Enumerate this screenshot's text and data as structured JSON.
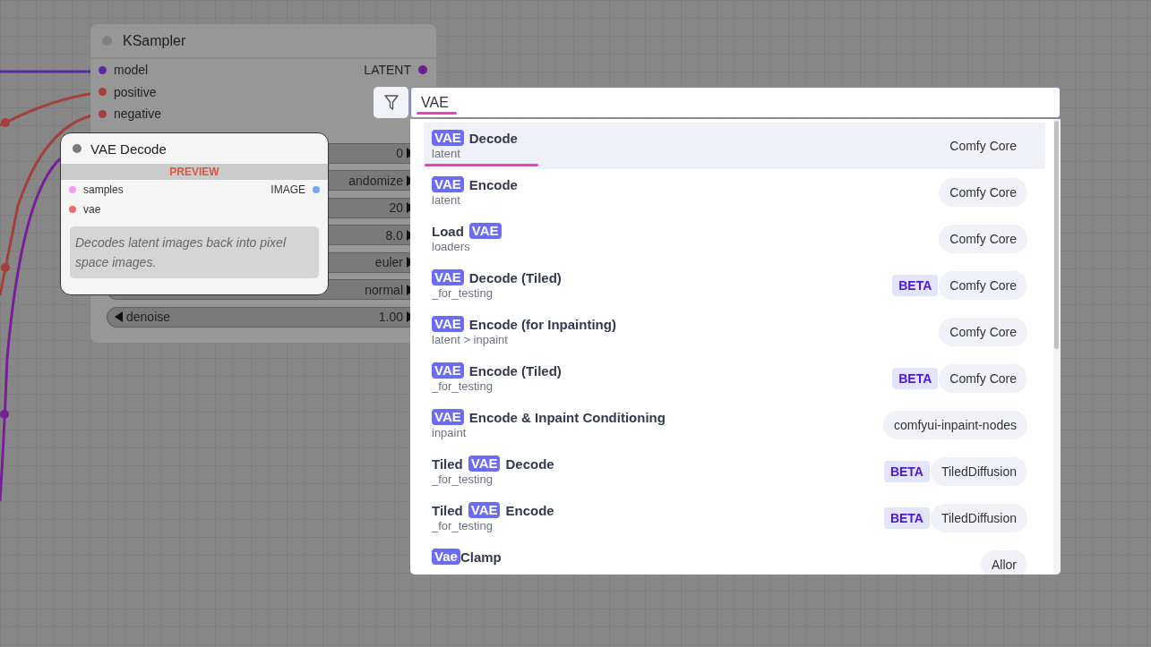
{
  "ksampler": {
    "title": "KSampler",
    "inputs": [
      {
        "label": "model",
        "color": "#5b2a9e"
      },
      {
        "label": "positive",
        "color": "#a3403c"
      },
      {
        "label": "negative",
        "color": "#a3403c"
      }
    ],
    "output": {
      "label": "LATENT",
      "color": "#6a1f8a"
    },
    "widgets": [
      {
        "value": "0"
      },
      {
        "value": "andomize"
      },
      {
        "value": "20"
      },
      {
        "value": "8.0"
      },
      {
        "value": "euler"
      },
      {
        "value": "normal"
      },
      {
        "label": "denoise",
        "value": "1.00"
      }
    ]
  },
  "vae_decode": {
    "title": "VAE Decode",
    "badge": "PREVIEW",
    "inputs": [
      {
        "label": "samples",
        "color": "#f59cf0"
      },
      {
        "label": "vae",
        "color": "#ef6b6b"
      }
    ],
    "output": {
      "label": "IMAGE",
      "color": "#7aa7f5"
    },
    "description": "Decodes latent images back into pixel space images."
  },
  "search": {
    "value": "VAE",
    "results": [
      {
        "name": [
          {
            "text": "VAE",
            "match": true
          },
          {
            "text": "Decode",
            "match": false
          }
        ],
        "category": "latent",
        "source": "Comfy Core",
        "beta": false,
        "selected": true
      },
      {
        "name": [
          {
            "text": "VAE",
            "match": true
          },
          {
            "text": "Encode",
            "match": false
          }
        ],
        "category": "latent",
        "source": "Comfy Core",
        "beta": false,
        "selected": false
      },
      {
        "name": [
          {
            "text": "Load",
            "match": false
          },
          {
            "text": "VAE",
            "match": true
          }
        ],
        "category": "loaders",
        "source": "Comfy Core",
        "beta": false,
        "selected": false
      },
      {
        "name": [
          {
            "text": "VAE",
            "match": true
          },
          {
            "text": "Decode (Tiled)",
            "match": false
          }
        ],
        "category": "_for_testing",
        "source": "Comfy Core",
        "beta": true,
        "beta_label": "BETA",
        "selected": false
      },
      {
        "name": [
          {
            "text": "VAE",
            "match": true
          },
          {
            "text": "Encode (for Inpainting)",
            "match": false
          }
        ],
        "category": "latent > inpaint",
        "source": "Comfy Core",
        "beta": false,
        "selected": false
      },
      {
        "name": [
          {
            "text": "VAE",
            "match": true
          },
          {
            "text": "Encode (Tiled)",
            "match": false
          }
        ],
        "category": "_for_testing",
        "source": "Comfy Core",
        "beta": true,
        "beta_label": "BETA",
        "selected": false
      },
      {
        "name": [
          {
            "text": "VAE",
            "match": true
          },
          {
            "text": "Encode & Inpaint Conditioning",
            "match": false
          }
        ],
        "category": "inpaint",
        "source": "comfyui-inpaint-nodes",
        "beta": false,
        "selected": false
      },
      {
        "name": [
          {
            "text": "Tiled",
            "match": false
          },
          {
            "text": "VAE",
            "match": true
          },
          {
            "text": "Decode",
            "match": false
          }
        ],
        "category": "_for_testing",
        "source": "TiledDiffusion",
        "beta": true,
        "beta_label": "BETA",
        "selected": false
      },
      {
        "name": [
          {
            "text": "Tiled",
            "match": false
          },
          {
            "text": "VAE",
            "match": true
          },
          {
            "text": "Encode",
            "match": false
          }
        ],
        "category": "_for_testing",
        "source": "TiledDiffusion",
        "beta": true,
        "beta_label": "BETA",
        "selected": false
      },
      {
        "name": [
          {
            "text": "Vae",
            "match": true,
            "tight": true
          },
          {
            "text": "Clamp",
            "match": false
          }
        ],
        "source": "Allor",
        "beta": false,
        "selected": false
      }
    ]
  }
}
